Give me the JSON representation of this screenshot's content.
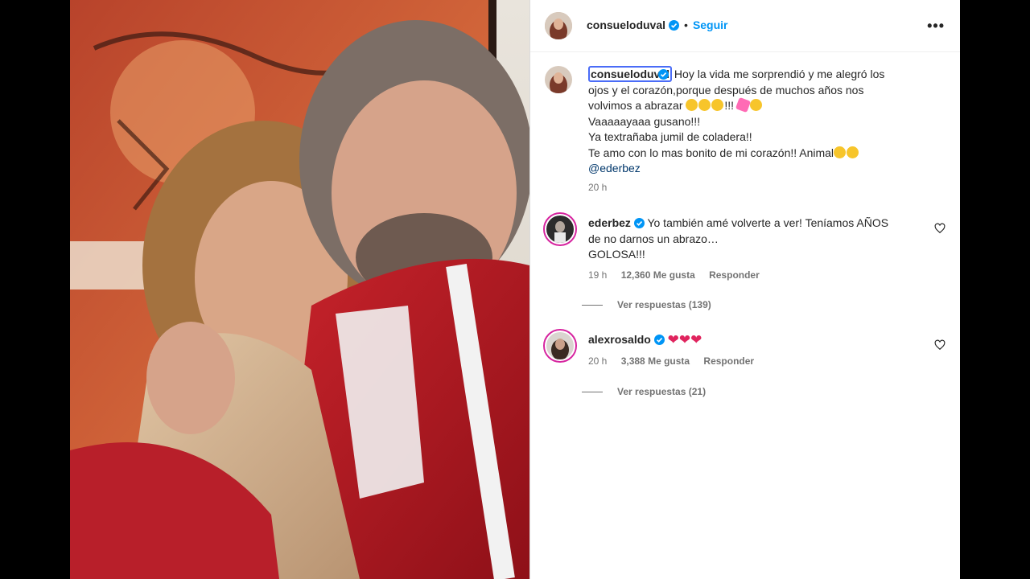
{
  "post": {
    "username": "consueloduval",
    "follow_label": "Seguir",
    "separator": "•",
    "more_label": "•••",
    "photo_alt": "Foto de dos personas abrazándose"
  },
  "caption": {
    "username": "consueloduval",
    "line1": "Hoy la vida me sorprendió y me alegró los",
    "line2": "ojos y el corazón,porque después de muchos años nos",
    "line3_text": "volvimos a abrazar",
    "line3_exclaim": "!!!",
    "line4": "Vaaaaayaaa gusano!!!",
    "line5": "Ya textrañaba jumil de coladera!!",
    "line6_text": "Te amo con lo mas bonito de mi corazón!! Animal",
    "mention": "@ederbez",
    "time": "20 h"
  },
  "comments": [
    {
      "username": "ederbez",
      "line1": "Yo también amé volverte a ver! Teníamos AÑOS",
      "line2": "de no darnos un abrazo…",
      "line3": "GOLOSA!!!",
      "time": "19 h",
      "likes": "12,360 Me gusta",
      "reply_label": "Responder",
      "view_replies": "Ver respuestas (139)"
    },
    {
      "username": "alexrosaldo",
      "hearts": "❤❤❤",
      "time": "20 h",
      "likes": "3,388 Me gusta",
      "reply_label": "Responder",
      "view_replies": "Ver respuestas (21)"
    }
  ],
  "colors": {
    "accent": "#0095f6",
    "verified": "#0095f6",
    "story_ring": "#d6249f",
    "heart": "#e0245e"
  }
}
